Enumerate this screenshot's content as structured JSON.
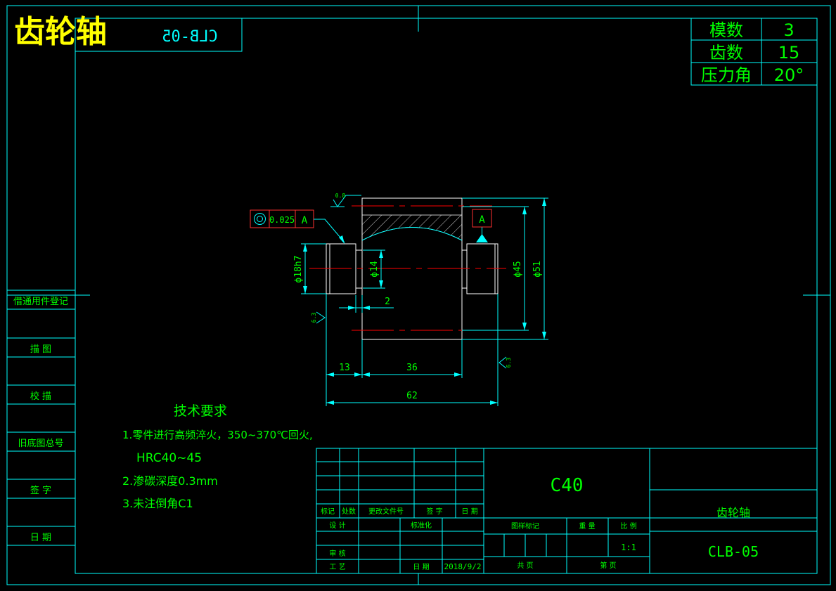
{
  "title": "齿轮轴",
  "mirrored_code": "CLB-05",
  "gear_params": [
    {
      "label": "模数",
      "value": "3"
    },
    {
      "label": "齿数",
      "value": "15"
    },
    {
      "label": "压力角",
      "value": "20°"
    }
  ],
  "left_strip": [
    "借通用件登记",
    "描 图",
    "校 描",
    "旧底图总号",
    "签 字",
    "日 期"
  ],
  "tolerance": {
    "value": "0.025",
    "datum": "A"
  },
  "datum_label": "A",
  "roughness": {
    "top": "0.8",
    "left": "6.3",
    "right": "6.3"
  },
  "dimensions": {
    "d18": "ϕ18h7",
    "d14": "ϕ14",
    "d45": "ϕ45",
    "d51": "ϕ51",
    "gap": "2",
    "len13": "13",
    "len36": "36",
    "len62": "62"
  },
  "tech_requirements": {
    "heading": "技术要求",
    "lines": [
      "1.零件进行高频淬火，350~370℃回火,",
      "HRC40~45",
      "2.渗碳深度0.3mm",
      "3.未注倒角C1"
    ]
  },
  "title_block": {
    "material": "C40",
    "part_name": "齿轮轴",
    "part_code": "CLB-05",
    "rev_headers": [
      "标记",
      "处数",
      "更改文件号",
      "签 字",
      "日 期"
    ],
    "design": "设 计",
    "standardize": "标准化",
    "review": "审 核",
    "process": "工 艺",
    "date_label": "日 期",
    "date_value": "2018/9/2",
    "stage_mark": "图样标记",
    "weight": "重 量",
    "scale": "比 例",
    "scale_value": "1:1",
    "total_sheets": "共    页",
    "sheet_no": "第    页"
  },
  "colors": {
    "frame": "#00ffff",
    "text": "#00ff00",
    "part": "#ffffff",
    "centerline": "#ff0000",
    "tolerance_box": "#ff3030",
    "title": "#ffff00"
  }
}
